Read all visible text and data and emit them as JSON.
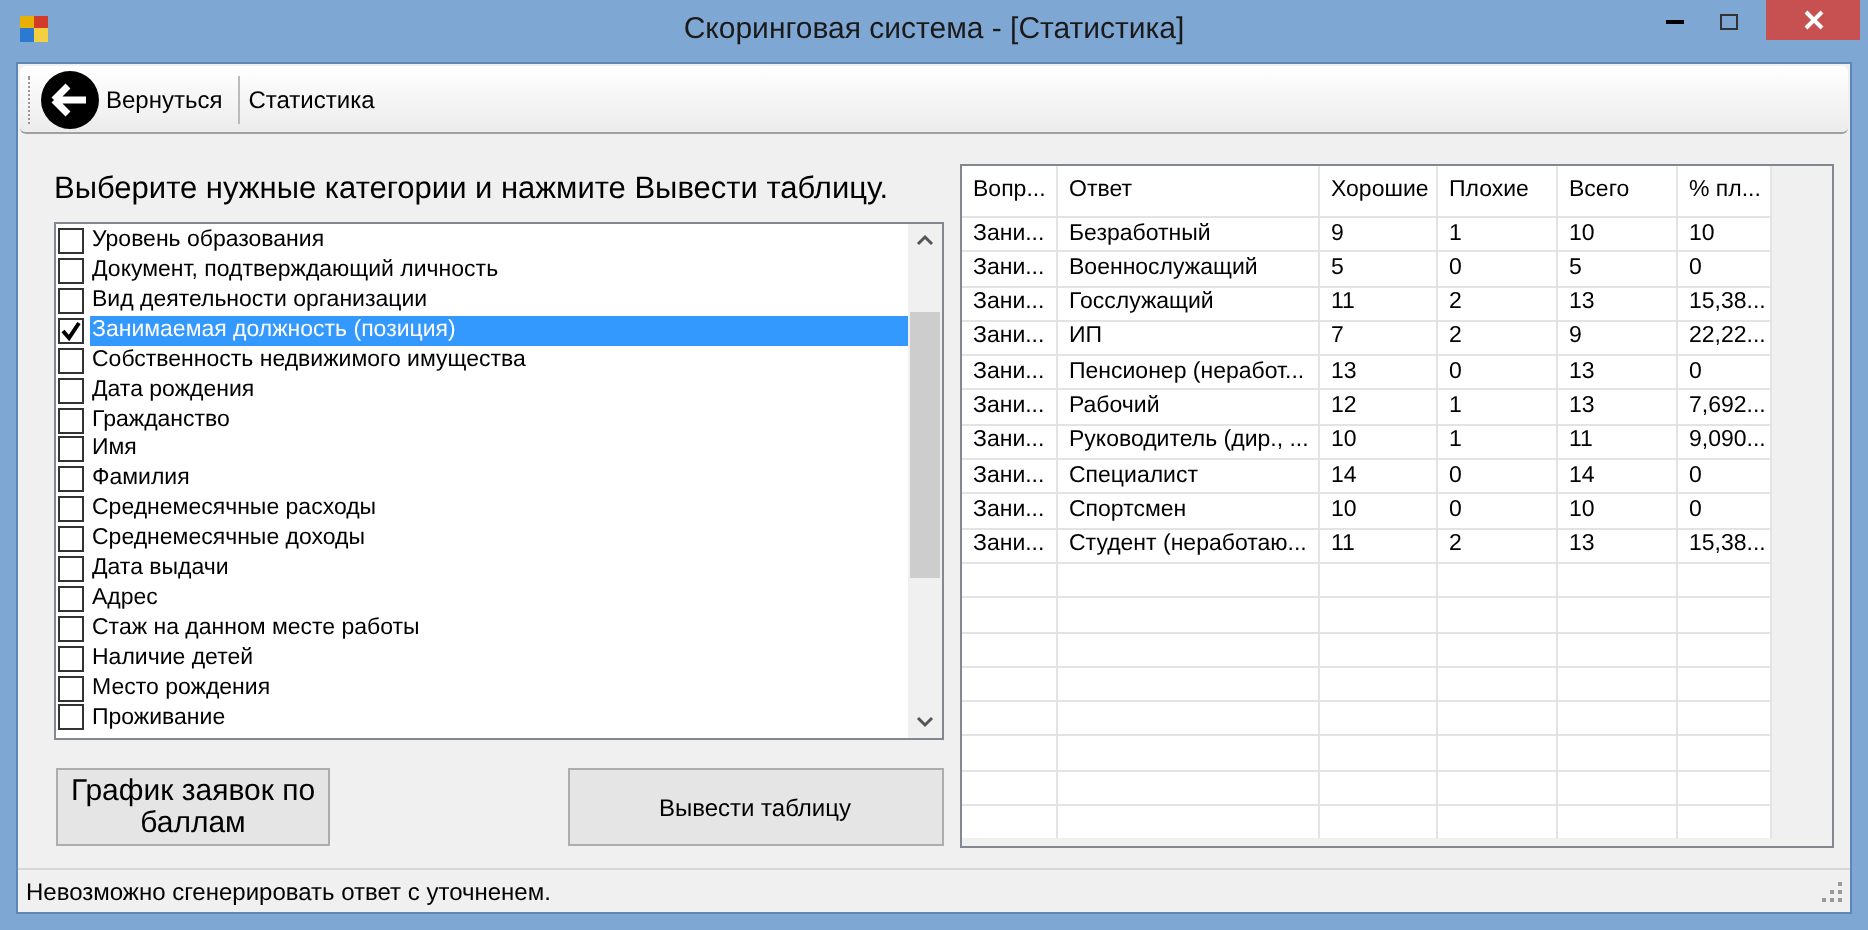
{
  "window": {
    "title": "Скоринговая система - [Статистика]"
  },
  "toolbar": {
    "back_button": "Вернуться",
    "label": "Статистика"
  },
  "instruction": "Выберите нужные категории и нажмите Вывести таблицу.",
  "categories": [
    {
      "label": "Уровень образования",
      "checked": false,
      "selected": false
    },
    {
      "label": "Документ, подтверждающий личность",
      "checked": false,
      "selected": false
    },
    {
      "label": "Вид деятельности организации",
      "checked": false,
      "selected": false
    },
    {
      "label": "Занимаемая должность (позиция)",
      "checked": true,
      "selected": true
    },
    {
      "label": "Собственность недвижимого имущества",
      "checked": false,
      "selected": false
    },
    {
      "label": "Дата рождения",
      "checked": false,
      "selected": false
    },
    {
      "label": "Гражданство",
      "checked": false,
      "selected": false
    },
    {
      "label": "Имя",
      "checked": false,
      "selected": false
    },
    {
      "label": "Фамилия",
      "checked": false,
      "selected": false
    },
    {
      "label": "Среднемесячные расходы",
      "checked": false,
      "selected": false
    },
    {
      "label": "Среднемесячные доходы",
      "checked": false,
      "selected": false
    },
    {
      "label": "Дата выдачи",
      "checked": false,
      "selected": false
    },
    {
      "label": "Адрес",
      "checked": false,
      "selected": false
    },
    {
      "label": "Стаж на данном месте работы",
      "checked": false,
      "selected": false
    },
    {
      "label": "Наличие детей",
      "checked": false,
      "selected": false
    },
    {
      "label": "Место рождения",
      "checked": false,
      "selected": false
    },
    {
      "label": "Проживание",
      "checked": false,
      "selected": false
    }
  ],
  "buttons": [
    "График заявок по баллам",
    "Вывести таблицу"
  ],
  "table": {
    "columns": [
      "Вопр...",
      "Ответ",
      "Хорошие",
      "Плохие",
      "Всего",
      "% пл..."
    ],
    "rows": [
      [
        "Зани...",
        "Безработный",
        "9",
        "1",
        "10",
        "10"
      ],
      [
        "Зани...",
        "Военнослужащий",
        "5",
        "0",
        "5",
        "0"
      ],
      [
        "Зани...",
        "Госслужащий",
        "11",
        "2",
        "13",
        "15,38..."
      ],
      [
        "Зани...",
        "ИП",
        "7",
        "2",
        "9",
        "22,22..."
      ],
      [
        "Зани...",
        "Пенсионер (неработ...",
        "13",
        "0",
        "13",
        "0"
      ],
      [
        "Зани...",
        "Рабочий",
        "12",
        "1",
        "13",
        "7,692..."
      ],
      [
        "Зани...",
        "Руководитель (дир., ...",
        "10",
        "1",
        "11",
        "9,090..."
      ],
      [
        "Зани...",
        "Специалист",
        "14",
        "0",
        "14",
        "0"
      ],
      [
        "Зани...",
        "Спортсмен",
        "10",
        "0",
        "10",
        "0"
      ],
      [
        "Зани...",
        "Студент (неработаю...",
        "11",
        "2",
        "13",
        "15,38..."
      ]
    ]
  },
  "status_bar": "Невозможно сгенерировать ответ с уточненем."
}
